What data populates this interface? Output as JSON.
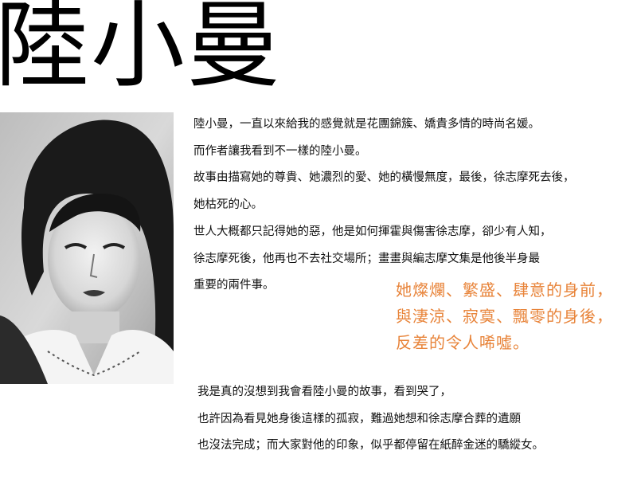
{
  "title": "陸小曼",
  "portrait": {
    "icon": "portrait-photo-icon"
  },
  "intro": [
    "陸小曼，一直以來給我的感覺就是花團錦簇、嬌貴多情的時尚名媛。",
    "而作者讓我看到不一樣的陸小曼。",
    "故事由描寫她的尊貴、她濃烈的愛、她的橫慢無度，最後，徐志摩死去後，",
    "她枯死的心。",
    "世人大概都只記得她的惡，他是如何揮霍與傷害徐志摩，卻少有人知，",
    "徐志摩死後，他再也不去社交場所；畫畫與編志摩文集是他後半身最",
    "重要的兩件事。"
  ],
  "quote": {
    "color": "#e8843a",
    "lines": [
      "她燦爛、繁盛、肆意的身前，",
      "與淒涼、寂寞、飄零的身後，",
      "反差的令人唏噓。"
    ]
  },
  "closing": [
    "我是真的沒想到我會看陸小曼的故事，看到哭了，",
    "也許因為看見她身後這樣的孤寂，難過她想和徐志摩合葬的遺願",
    "也沒法完成；而大家對他的印象，似乎都停留在紙醉金迷的驕縱女。"
  ]
}
